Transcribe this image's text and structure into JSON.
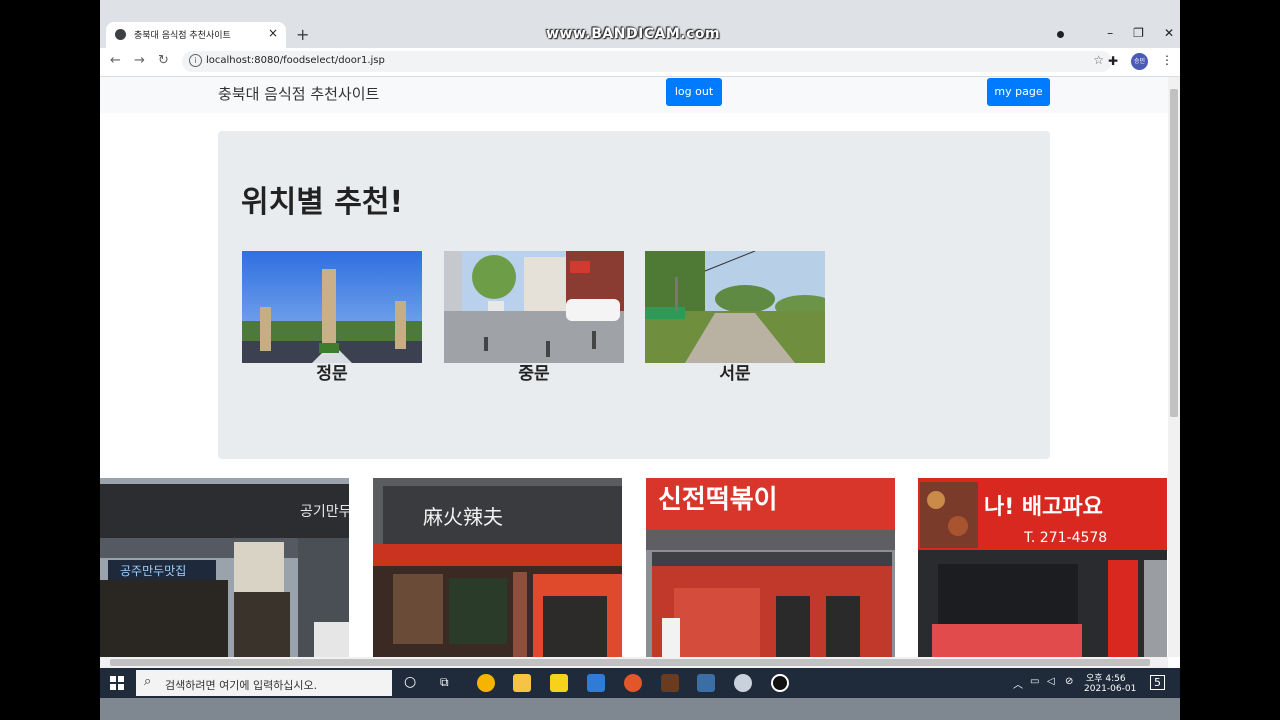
{
  "browser": {
    "tab_title": "충북대 음식점 추천사이트",
    "tab_close": "×",
    "new_tab": "+",
    "watermark": "www.BANDICAM.com",
    "url": "localhost:8080/foodselect/door1.jsp",
    "window_controls": [
      "–",
      "❐",
      "✕"
    ],
    "profile_initials": "승민"
  },
  "navbar": {
    "brand": "충북대 음식점 추천사이트",
    "logout_label": "log out",
    "mypage_label": "my page"
  },
  "jumbotron": {
    "title": "위치별 추천!",
    "locations": [
      {
        "label": "정문",
        "icon": "main-gate-photo"
      },
      {
        "label": "중문",
        "icon": "middle-gate-photo"
      },
      {
        "label": "서문",
        "icon": "west-gate-photo"
      }
    ]
  },
  "restaurants": [
    {
      "sign_text": "공기만두",
      "sub_text": "공주만두맛집",
      "sign_color": "#2b2d31"
    },
    {
      "sign_text": "麻火辣夫",
      "sub_text": "",
      "sign_color": "#3a3b3f"
    },
    {
      "sign_text": "신전떡볶이",
      "sub_text": "",
      "sign_color": "#d9362b"
    },
    {
      "sign_text": "나! 배고파요",
      "sub_text": "T. 271-4578",
      "sign_color": "#d8281f"
    }
  ],
  "taskbar": {
    "search_placeholder": "검색하려면 여기에 입력하십시오.",
    "time": "오후 4:56",
    "date": "2021-06-01",
    "notification_count": "5"
  }
}
